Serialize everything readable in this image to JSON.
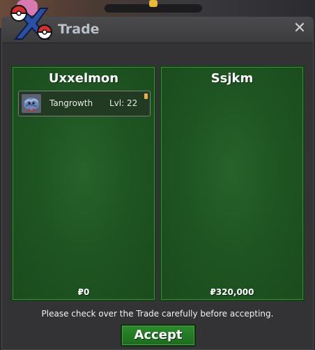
{
  "window": {
    "title": "Trade",
    "close_label": "✕"
  },
  "left_panel": {
    "player_name": "Uxxelmon",
    "money": "₽0",
    "pokemon": [
      {
        "name": "Tangrowth",
        "level": "Lvl: 22",
        "icon": "tangrowth-icon"
      }
    ]
  },
  "right_panel": {
    "player_name": "Ssjkm",
    "money": "₽320,000"
  },
  "footer": {
    "notice": "Please check over the Trade carefully before accepting.",
    "accept_label": "Accept"
  },
  "colors": {
    "panel_green": "#1f5522",
    "accept_green": "#2d8a2c",
    "window_gray": "#333335"
  }
}
